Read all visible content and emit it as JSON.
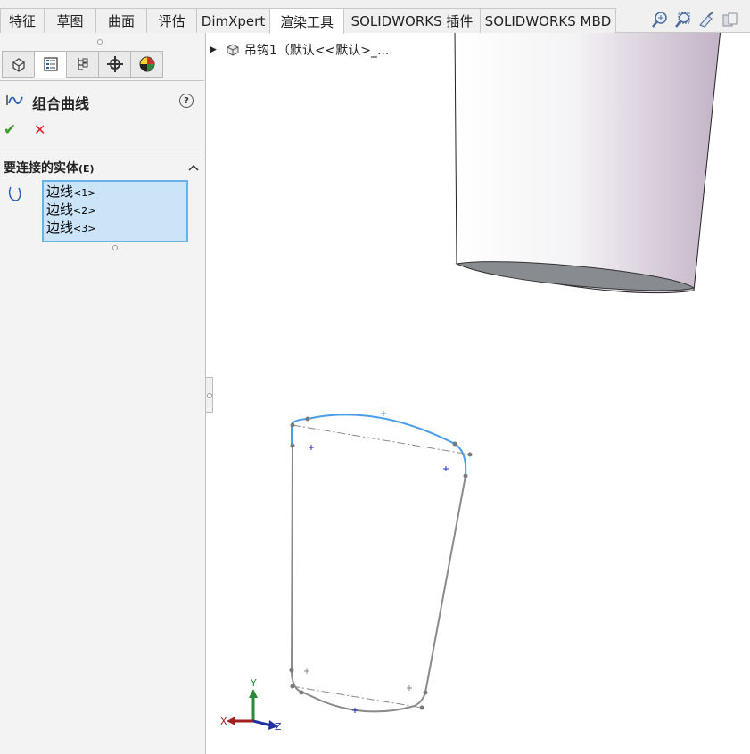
{
  "ribbon": {
    "tabs": [
      {
        "label": "特征"
      },
      {
        "label": "草图"
      },
      {
        "label": "曲面"
      },
      {
        "label": "评估"
      },
      {
        "label": "DimXpert"
      },
      {
        "label": "渲染工具"
      },
      {
        "label": "SOLIDWORKS 插件"
      },
      {
        "label": "SOLIDWORKS MBD"
      }
    ],
    "active_tab": "渲染工具",
    "view_icons": [
      "zoom-to-fit-icon",
      "zoom-to-area-icon",
      "previous-view-icon",
      "section-view-icon"
    ]
  },
  "property_manager": {
    "tab_icons": [
      "feature-manager-icon",
      "property-manager-icon",
      "configuration-manager-icon",
      "dimxpert-manager-icon",
      "display-manager-icon"
    ],
    "feature_title": "组合曲线",
    "help_label": "?",
    "ok_label": "✔",
    "cancel_label": "✕",
    "group": {
      "title": "要连接的实体",
      "shortcut": "(E)",
      "items": [
        {
          "name": "边线",
          "index": "<1>"
        },
        {
          "name": "边线",
          "index": "<2>"
        },
        {
          "name": "边线",
          "index": "<3>"
        }
      ]
    }
  },
  "tree_flyout": {
    "label": "吊钩1（默认<<默认>_..."
  },
  "triad": {
    "x_label": "X",
    "y_label": "Y",
    "z_label": "Z"
  },
  "colors": {
    "selection_fill": "#cce4f7",
    "selection_border": "#66b3ea",
    "selected_curve": "#4a9ee8",
    "sketch_line": "#8a8a8a"
  }
}
